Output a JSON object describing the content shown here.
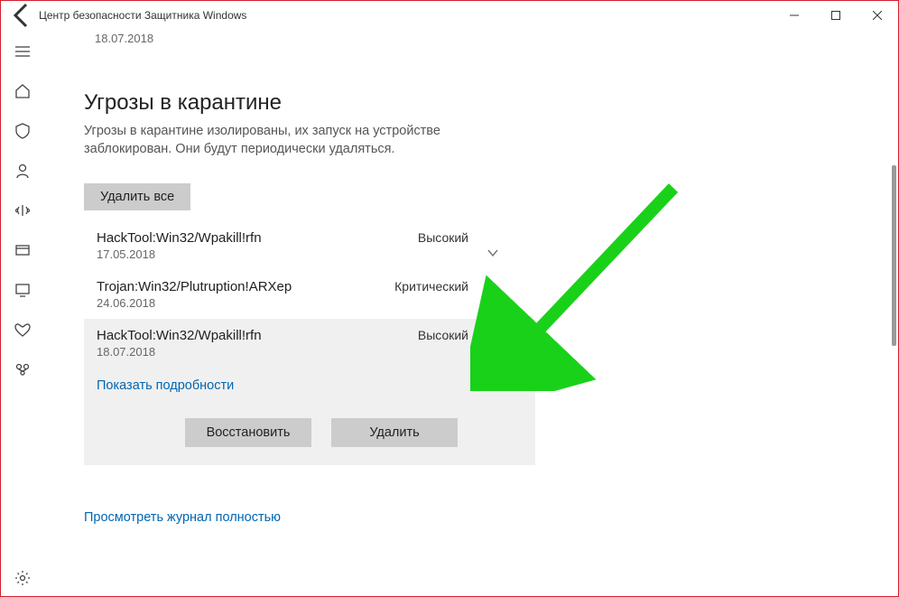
{
  "window": {
    "title": "Центр безопасности Защитника Windows"
  },
  "top_date": "18.07.2018",
  "page": {
    "heading": "Угрозы в карантине",
    "subtitle": "Угрозы в карантине изолированы, их запуск на устройстве заблокирован. Они будут периодически удаляться.",
    "delete_all": "Удалить все",
    "view_full": "Просмотреть журнал полностью"
  },
  "threats": [
    {
      "name": "HackTool:Win32/Wpakill!rfn",
      "date": "17.05.2018",
      "severity": "Высокий",
      "expanded": false
    },
    {
      "name": "Trojan:Win32/Plutruption!ARXep",
      "date": "24.06.2018",
      "severity": "Критический",
      "expanded": false
    },
    {
      "name": "HackTool:Win32/Wpakill!rfn",
      "date": "18.07.2018",
      "severity": "Высокий",
      "expanded": true
    }
  ],
  "expanded_panel": {
    "show_details": "Показать подробности",
    "restore": "Восстановить",
    "remove": "Удалить"
  }
}
